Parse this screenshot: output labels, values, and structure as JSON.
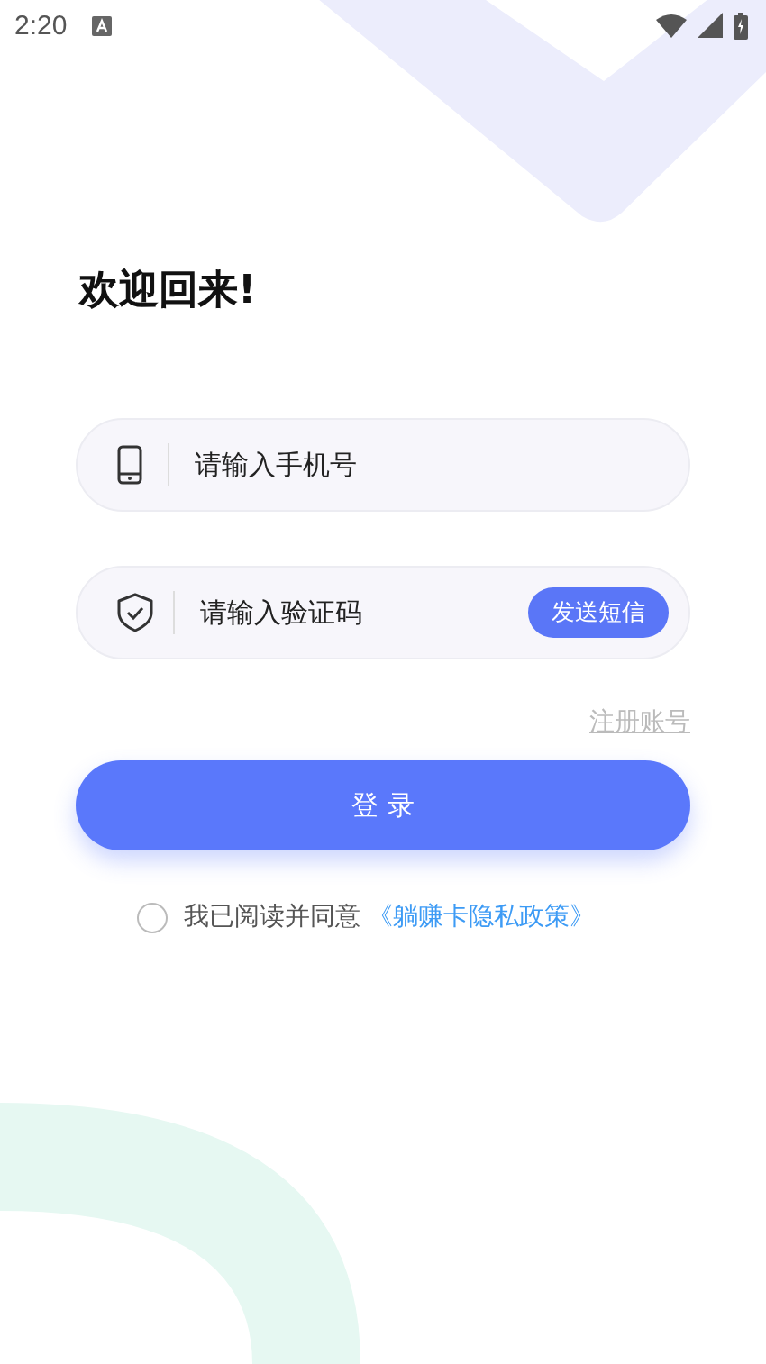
{
  "status_bar": {
    "time": "2:20"
  },
  "title": "欢迎回来!",
  "phone_field": {
    "placeholder": "请输入手机号"
  },
  "code_field": {
    "placeholder": "请输入验证码"
  },
  "send_button": "发送短信",
  "register_link": "注册账号",
  "login_button": "登 录",
  "agreement": {
    "checked": false,
    "text": "我已阅读并同意",
    "link": "《躺赚卡隐私政策》"
  }
}
